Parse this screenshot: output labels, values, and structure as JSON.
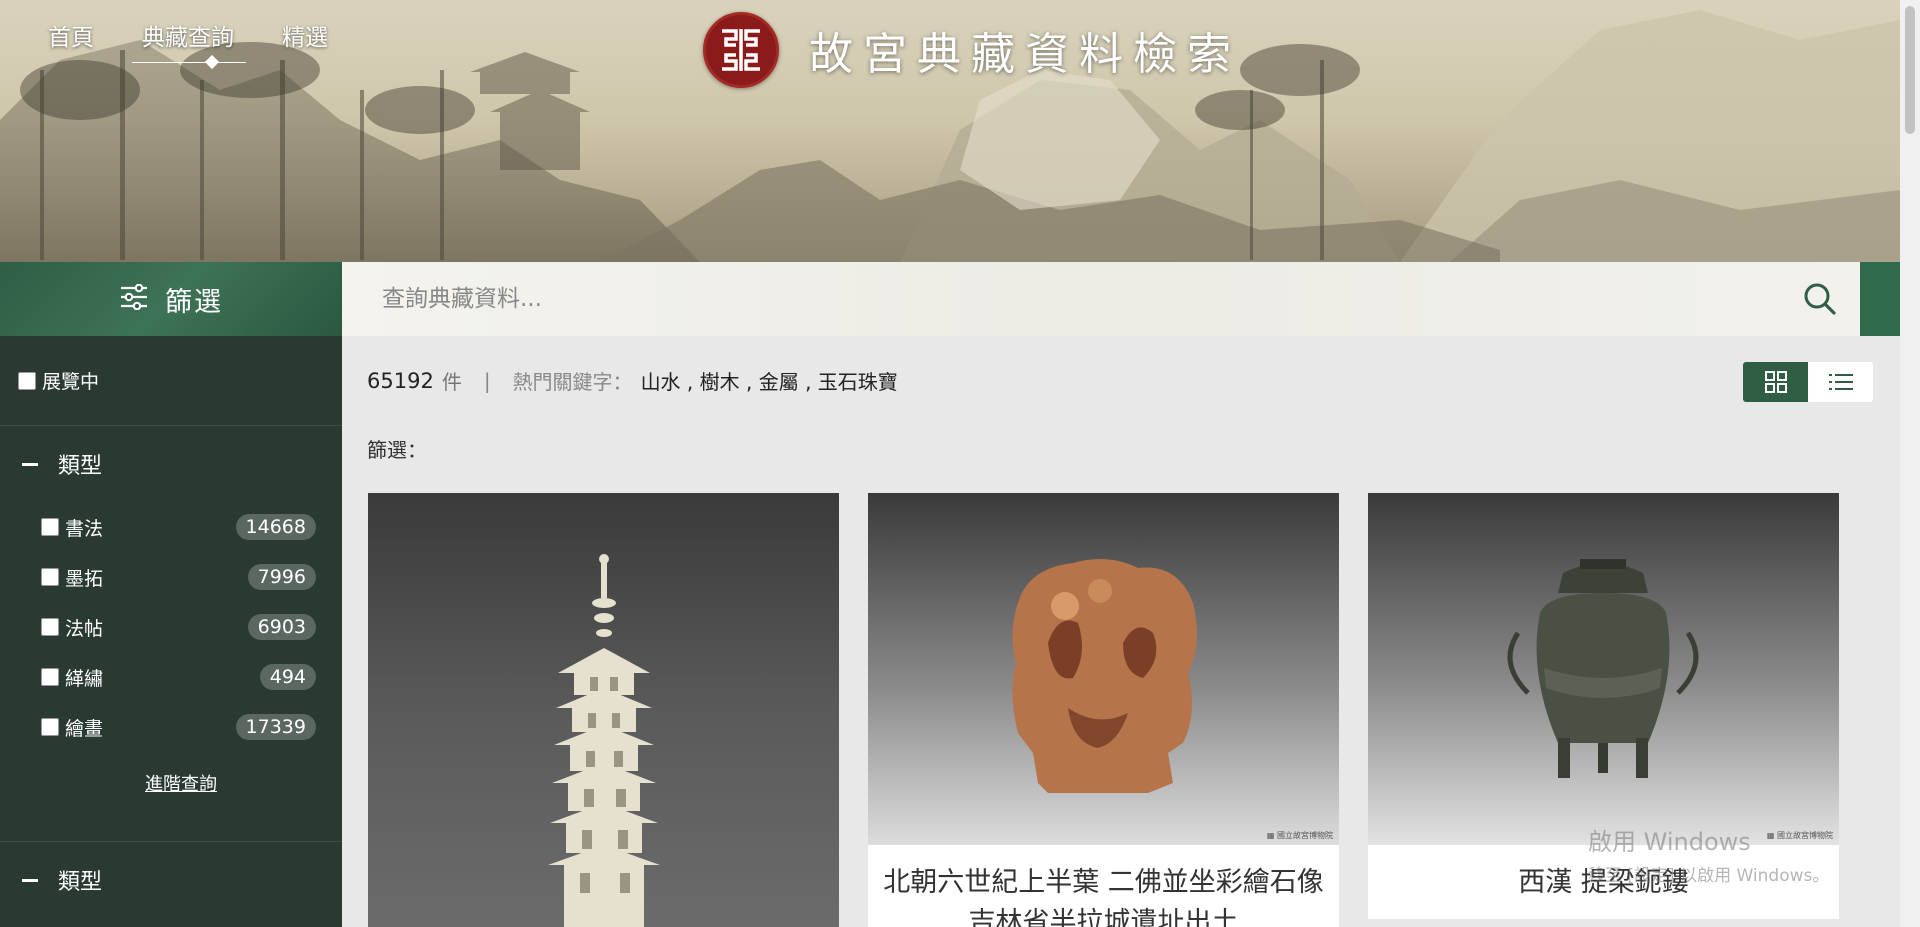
{
  "nav": {
    "home": "首頁",
    "collection": "典藏查詢",
    "featured": "精選"
  },
  "brand": {
    "title": "故宮典藏資料檢索",
    "logo_icon": "museum-seal-logo-icon"
  },
  "filter": {
    "label": "篩選"
  },
  "search": {
    "placeholder": "查詢典藏資料..."
  },
  "sidebar": {
    "exhibit_label": "展覽中",
    "section1_title": "類型",
    "categories": [
      {
        "label": "書法",
        "count": "14668"
      },
      {
        "label": "墨拓",
        "count": "7996"
      },
      {
        "label": "法帖",
        "count": "6903"
      },
      {
        "label": "緙繡",
        "count": "494"
      },
      {
        "label": "繪畫",
        "count": "17339"
      }
    ],
    "advanced": "進階查詢",
    "section2_title": "類型"
  },
  "results": {
    "count": "65192",
    "unit": "件",
    "separator": "|",
    "keywords_label": "熱門關鍵字：",
    "keywords": "山水 , 樹木 , 金屬 , 玉石珠寶",
    "filter_label": "篩選："
  },
  "cards": [
    {
      "title": ""
    },
    {
      "title": "北朝六世紀上半葉 二佛並坐彩繪石像 吉林省半拉城遺址出土"
    },
    {
      "title": "西漢 提梁鈪鏤"
    }
  ],
  "watermark": {
    "line1": "啟用 Windows",
    "line2": "移至 [設定] 以啟用 Windows。"
  },
  "colors": {
    "accent": "#2f5e45",
    "sidebar": "#2a3a33",
    "seal": "#8b1a1a"
  }
}
